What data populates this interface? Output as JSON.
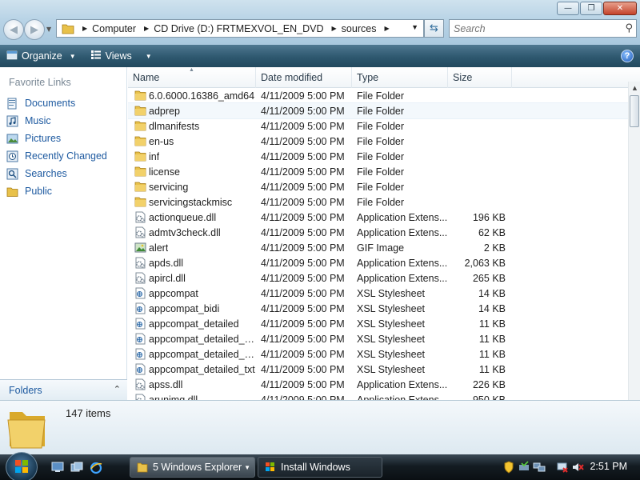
{
  "address": {
    "crumbs": [
      "Computer",
      "CD Drive (D:) FRTMEXVOL_EN_DVD",
      "sources"
    ]
  },
  "search": {
    "placeholder": "Search"
  },
  "toolbar": {
    "organize_label": "Organize",
    "views_label": "Views",
    "help_label": "?"
  },
  "nav": {
    "heading": "Favorite Links",
    "items": [
      {
        "label": "Documents",
        "icon": "documents-icon"
      },
      {
        "label": "Music",
        "icon": "music-icon"
      },
      {
        "label": "Pictures",
        "icon": "pictures-icon"
      },
      {
        "label": "Recently Changed",
        "icon": "recently-changed-icon"
      },
      {
        "label": "Searches",
        "icon": "searches-icon"
      },
      {
        "label": "Public",
        "icon": "public-folder-icon"
      }
    ],
    "folders_label": "Folders"
  },
  "columns": {
    "name": "Name",
    "date": "Date modified",
    "type": "Type",
    "size": "Size"
  },
  "files": [
    {
      "name": "6.0.6000.16386_amd64",
      "date": "4/11/2009 5:00 PM",
      "type": "File Folder",
      "size": "",
      "icon": "folder"
    },
    {
      "name": "adprep",
      "date": "4/11/2009 5:00 PM",
      "type": "File Folder",
      "size": "",
      "icon": "folder"
    },
    {
      "name": "dlmanifests",
      "date": "4/11/2009 5:00 PM",
      "type": "File Folder",
      "size": "",
      "icon": "folder"
    },
    {
      "name": "en-us",
      "date": "4/11/2009 5:00 PM",
      "type": "File Folder",
      "size": "",
      "icon": "folder"
    },
    {
      "name": "inf",
      "date": "4/11/2009 5:00 PM",
      "type": "File Folder",
      "size": "",
      "icon": "folder"
    },
    {
      "name": "license",
      "date": "4/11/2009 5:00 PM",
      "type": "File Folder",
      "size": "",
      "icon": "folder"
    },
    {
      "name": "servicing",
      "date": "4/11/2009 5:00 PM",
      "type": "File Folder",
      "size": "",
      "icon": "folder"
    },
    {
      "name": "servicingstackmisc",
      "date": "4/11/2009 5:00 PM",
      "type": "File Folder",
      "size": "",
      "icon": "folder"
    },
    {
      "name": "actionqueue.dll",
      "date": "4/11/2009 5:00 PM",
      "type": "Application Extens...",
      "size": "196 KB",
      "icon": "dll"
    },
    {
      "name": "admtv3check.dll",
      "date": "4/11/2009 5:00 PM",
      "type": "Application Extens...",
      "size": "62 KB",
      "icon": "dll"
    },
    {
      "name": "alert",
      "date": "4/11/2009 5:00 PM",
      "type": "GIF Image",
      "size": "2 KB",
      "icon": "gif"
    },
    {
      "name": "apds.dll",
      "date": "4/11/2009 5:00 PM",
      "type": "Application Extens...",
      "size": "2,063 KB",
      "icon": "dll"
    },
    {
      "name": "apircl.dll",
      "date": "4/11/2009 5:00 PM",
      "type": "Application Extens...",
      "size": "265 KB",
      "icon": "dll"
    },
    {
      "name": "appcompat",
      "date": "4/11/2009 5:00 PM",
      "type": "XSL Stylesheet",
      "size": "14 KB",
      "icon": "xsl"
    },
    {
      "name": "appcompat_bidi",
      "date": "4/11/2009 5:00 PM",
      "type": "XSL Stylesheet",
      "size": "14 KB",
      "icon": "xsl"
    },
    {
      "name": "appcompat_detailed",
      "date": "4/11/2009 5:00 PM",
      "type": "XSL Stylesheet",
      "size": "11 KB",
      "icon": "xsl"
    },
    {
      "name": "appcompat_detailed_b...",
      "date": "4/11/2009 5:00 PM",
      "type": "XSL Stylesheet",
      "size": "11 KB",
      "icon": "xsl"
    },
    {
      "name": "appcompat_detailed_b...",
      "date": "4/11/2009 5:00 PM",
      "type": "XSL Stylesheet",
      "size": "11 KB",
      "icon": "xsl"
    },
    {
      "name": "appcompat_detailed_txt",
      "date": "4/11/2009 5:00 PM",
      "type": "XSL Stylesheet",
      "size": "11 KB",
      "icon": "xsl"
    },
    {
      "name": "apss.dll",
      "date": "4/11/2009 5:00 PM",
      "type": "Application Extens...",
      "size": "226 KB",
      "icon": "dll"
    },
    {
      "name": "arunimg.dll",
      "date": "4/11/2009 5:00 PM",
      "type": "Application Extens...",
      "size": "950 KB",
      "icon": "dll"
    }
  ],
  "status": {
    "item_count": "147 items"
  },
  "taskbar": {
    "explorer_label": "5 Windows Explorer",
    "install_label": "Install Windows",
    "clock": "2:51 PM"
  },
  "colors": {
    "link_blue": "#1e5aa0",
    "command_bar": "#2e586f",
    "folder_yellow": "#e8c14a"
  }
}
